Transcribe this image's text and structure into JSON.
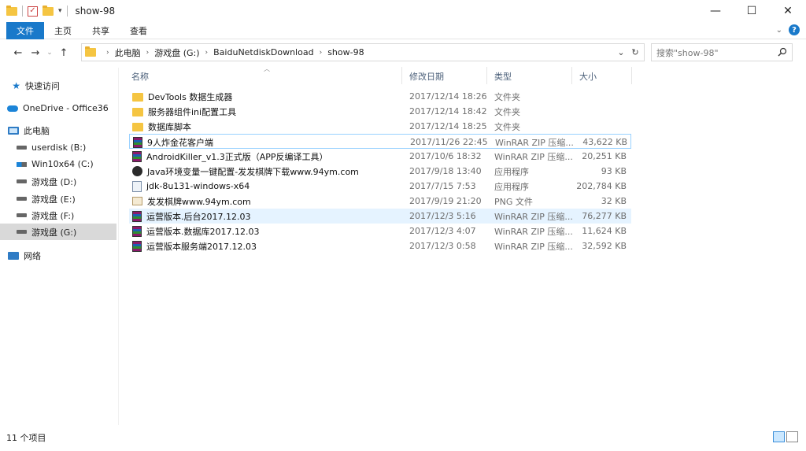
{
  "window": {
    "title": "show-98",
    "minimize": "—",
    "maximize": "☐",
    "close": "✕"
  },
  "ribbon": {
    "tabs": [
      "文件",
      "主页",
      "共享",
      "查看"
    ]
  },
  "address": {
    "crumbs": [
      "此电脑",
      "游戏盘 (G:)",
      "BaiduNetdiskDownload",
      "show-98"
    ],
    "search_placeholder": "搜索\"show-98\""
  },
  "nav": {
    "items": [
      {
        "label": "快速访问",
        "icon": "star-icon"
      },
      {
        "label": "OneDrive - Office36",
        "icon": "cloud-icon"
      },
      {
        "label": "此电脑",
        "icon": "computer-icon"
      },
      {
        "label": "userdisk (B:)",
        "icon": "drive-icon"
      },
      {
        "label": "Win10x64 (C:)",
        "icon": "windows-drive-icon"
      },
      {
        "label": "游戏盘 (D:)",
        "icon": "drive-icon"
      },
      {
        "label": "游戏盘 (E:)",
        "icon": "drive-icon"
      },
      {
        "label": "游戏盘 (F:)",
        "icon": "drive-icon"
      },
      {
        "label": "游戏盘 (G:)",
        "icon": "drive-icon",
        "selected": true
      },
      {
        "label": "网络",
        "icon": "network-icon"
      }
    ]
  },
  "columns": {
    "name": "名称",
    "date": "修改日期",
    "type": "类型",
    "size": "大小"
  },
  "files": [
    {
      "name": "DevTools 数据生成器",
      "date": "2017/12/14 18:26",
      "type": "文件夹",
      "size": "",
      "icon": "folder-icon"
    },
    {
      "name": "服务器组件ini配置工具",
      "date": "2017/12/14 18:42",
      "type": "文件夹",
      "size": "",
      "icon": "folder-icon"
    },
    {
      "name": "数据库脚本",
      "date": "2017/12/14 18:25",
      "type": "文件夹",
      "size": "",
      "icon": "folder-icon"
    },
    {
      "name": "9人炸金花客户端",
      "date": "2017/11/26 22:45",
      "type": "WinRAR ZIP 压缩...",
      "size": "43,622 KB",
      "icon": "winrar-icon",
      "state": "focus"
    },
    {
      "name": "AndroidKiller_v1.3正式版（APP反编译工具）",
      "date": "2017/10/6 18:32",
      "type": "WinRAR ZIP 压缩...",
      "size": "20,251 KB",
      "icon": "winrar-icon"
    },
    {
      "name": "Java环境变量一键配置-发发棋牌下载www.94ym.com",
      "date": "2017/9/18 13:40",
      "type": "应用程序",
      "size": "93 KB",
      "icon": "app-icon"
    },
    {
      "name": "jdk-8u131-windows-x64",
      "date": "2017/7/15 7:53",
      "type": "应用程序",
      "size": "202,784 KB",
      "icon": "installer-icon"
    },
    {
      "name": "发发棋牌www.94ym.com",
      "date": "2017/9/19 21:20",
      "type": "PNG 文件",
      "size": "32 KB",
      "icon": "image-icon"
    },
    {
      "name": "运营版本.后台2017.12.03",
      "date": "2017/12/3 5:16",
      "type": "WinRAR ZIP 压缩...",
      "size": "76,277 KB",
      "icon": "winrar-icon",
      "state": "hover"
    },
    {
      "name": "运营版本.数据库2017.12.03",
      "date": "2017/12/3 4:07",
      "type": "WinRAR ZIP 压缩...",
      "size": "11,624 KB",
      "icon": "winrar-icon"
    },
    {
      "name": "运营版本服务端2017.12.03",
      "date": "2017/12/3 0:58",
      "type": "WinRAR ZIP 压缩...",
      "size": "32,592 KB",
      "icon": "winrar-icon"
    }
  ],
  "status": {
    "count": "11 个项目"
  },
  "colors": {
    "accent": "#1979ca",
    "hover": "#e5f3ff",
    "selected_nav": "#d9d9d9"
  }
}
